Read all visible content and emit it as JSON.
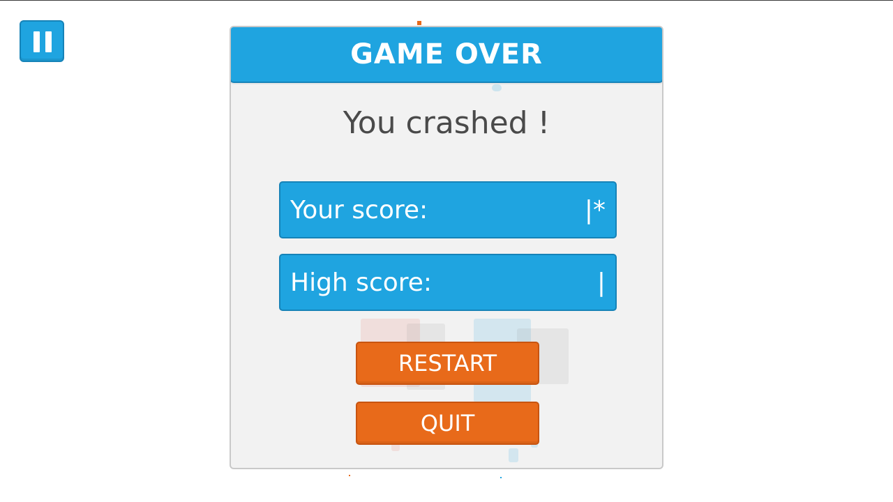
{
  "hud": {
    "pause_icon": "pause-icon"
  },
  "dialog": {
    "title": "GAME OVER",
    "message": "You crashed !",
    "your_score_label": "Your score:",
    "your_score_value": "|*",
    "high_score_label": "High score:",
    "high_score_value": "|",
    "restart_label": "RESTART",
    "quit_label": "QUIT"
  },
  "colors": {
    "primary_blue": "#1fa4e0",
    "action_orange": "#e86a1a",
    "panel_bg": "#f2f2f2",
    "text_dark": "#4a4a4a"
  }
}
